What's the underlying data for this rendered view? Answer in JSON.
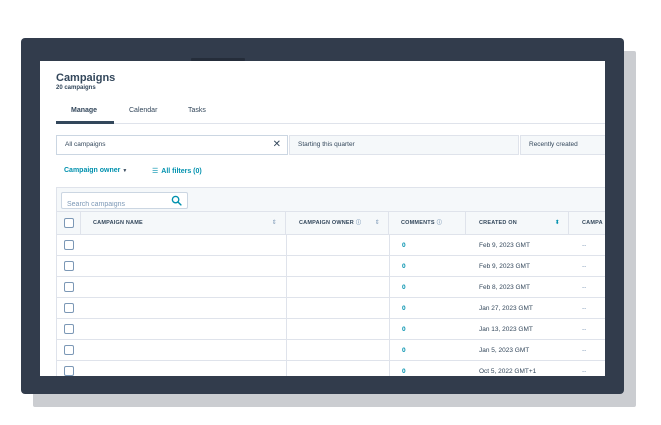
{
  "header": {
    "title": "Campaigns",
    "subtitle": "20 campaigns"
  },
  "tabs": [
    {
      "label": "Manage",
      "active": true
    },
    {
      "label": "Calendar",
      "active": false
    },
    {
      "label": "Tasks",
      "active": false
    }
  ],
  "views": [
    {
      "label": "All campaigns",
      "closable": true
    },
    {
      "label": "Starting this quarter"
    },
    {
      "label": "Recently created"
    }
  ],
  "views_close_icon": "close-icon",
  "filters": {
    "owner_label": "Campaign owner",
    "all_filters_label": "All filters (0)"
  },
  "search": {
    "placeholder": "Search campaigns"
  },
  "columns": [
    {
      "label": "CAMPAIGN NAME"
    },
    {
      "label": "CAMPAIGN OWNER"
    },
    {
      "label": "COMMENTS"
    },
    {
      "label": "CREATED ON"
    },
    {
      "label": "CAMPA"
    }
  ],
  "rows": [
    {
      "comments": "0",
      "created_on": "Feb 9, 2023 GMT",
      "extra": "--"
    },
    {
      "comments": "0",
      "created_on": "Feb 9, 2023 GMT",
      "extra": "--"
    },
    {
      "comments": "0",
      "created_on": "Feb 8, 2023 GMT",
      "extra": "--"
    },
    {
      "comments": "0",
      "created_on": "Jan 27, 2023 GMT",
      "extra": "--"
    },
    {
      "comments": "0",
      "created_on": "Jan 13, 2023 GMT",
      "extra": "--"
    },
    {
      "comments": "0",
      "created_on": "Jan 5, 2023 GMT",
      "extra": "--"
    },
    {
      "comments": "0",
      "created_on": "Oct 5, 2022 GMT+1",
      "extra": "--"
    }
  ],
  "colors": {
    "accent": "#0091ae",
    "text": "#33475b",
    "frame": "#323c4c"
  }
}
